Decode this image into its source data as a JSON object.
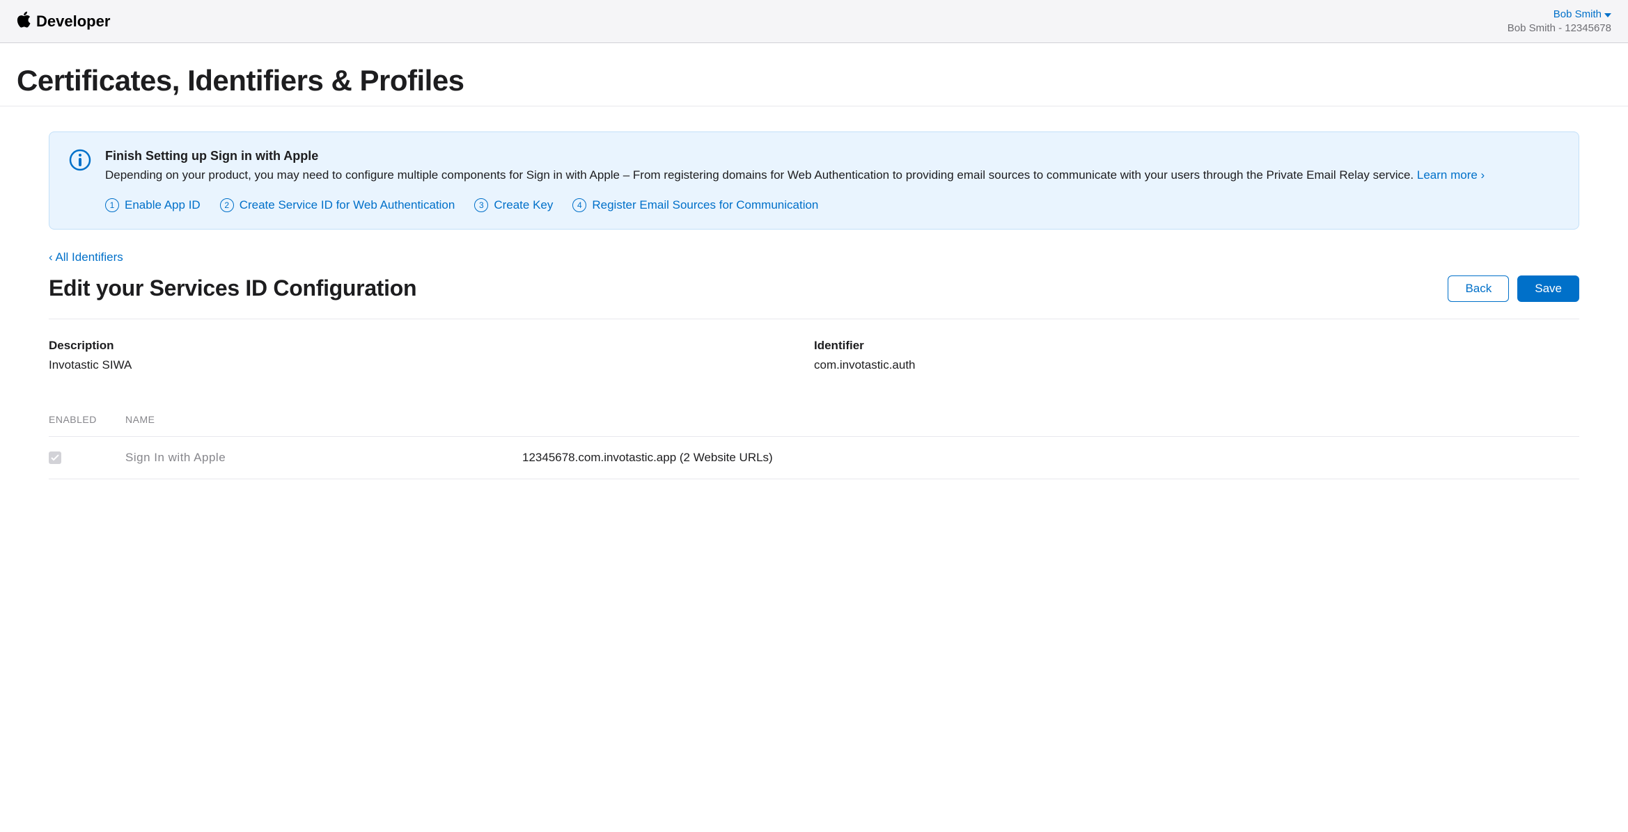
{
  "header": {
    "brand": "Developer",
    "user_name": "Bob Smith",
    "user_team": "Bob Smith - 12345678"
  },
  "page_title": "Certificates, Identifiers & Profiles",
  "info_banner": {
    "title": "Finish Setting up Sign in with Apple",
    "description": "Depending on your product, you may need to configure multiple components for Sign in with Apple – From registering domains for Web Authentication to providing email sources to communicate with your users through the Private Email Relay service. ",
    "learn_more": "Learn more ›",
    "steps": [
      "Enable App ID",
      "Create Service ID for Web Authentication",
      "Create Key",
      "Register Email Sources for Communication"
    ]
  },
  "back_link": "‹ All Identifiers",
  "section": {
    "title": "Edit your Services ID Configuration",
    "back_button": "Back",
    "save_button": "Save"
  },
  "details": {
    "description_label": "Description",
    "description_value": "Invotastic SIWA",
    "identifier_label": "Identifier",
    "identifier_value": "com.invotastic.auth"
  },
  "table": {
    "header_enabled": "ENABLED",
    "header_name": "NAME",
    "rows": [
      {
        "name": "Sign In with Apple",
        "config": "12345678.com.invotastic.app (2 Website URLs)"
      }
    ]
  }
}
